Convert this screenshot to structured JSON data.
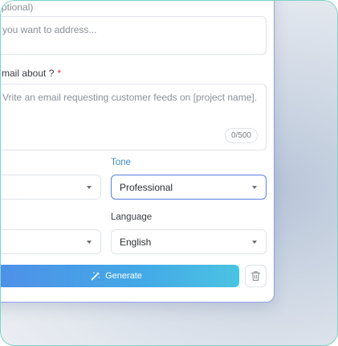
{
  "recipient": {
    "label_fragment": "ptional)",
    "placeholder": "you want to address..."
  },
  "about": {
    "label": "mail about ?",
    "required_mark": "*",
    "placeholder": "Vrite an email requesting customer feeds on [project name].",
    "counter": "0/500"
  },
  "tone": {
    "label": "Tone",
    "value": "Professional"
  },
  "language": {
    "label": "Language",
    "value": "English"
  },
  "actions": {
    "generate_label": "Generate"
  },
  "colors": {
    "accent": "#3c8bd0",
    "required": "#e0343a",
    "button_start": "#4f8fe8",
    "button_end": "#4cc3e2"
  }
}
